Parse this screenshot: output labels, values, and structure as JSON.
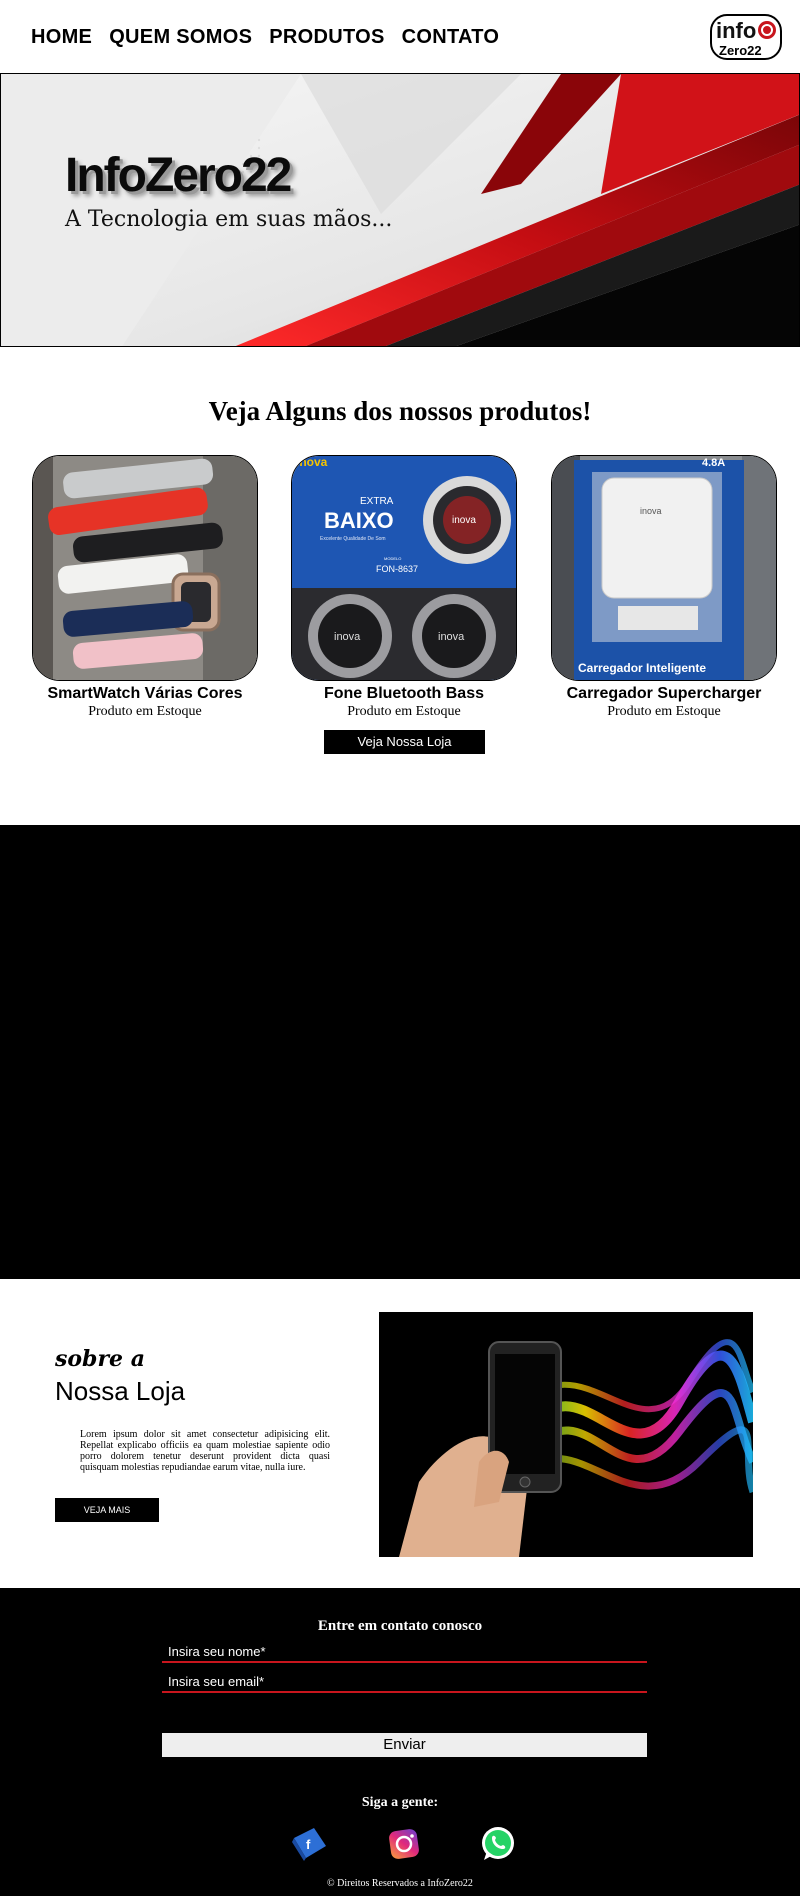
{
  "nav": {
    "items": [
      {
        "label": "HOME"
      },
      {
        "label": "QUEM SOMOS"
      },
      {
        "label": "PRODUTOS"
      },
      {
        "label": "CONTATO"
      }
    ],
    "logo_text_top": "info",
    "logo_text_bottom": "Zero22"
  },
  "hero": {
    "title": "InfoZero22",
    "subtitle": "A Tecnologia em suas mãos..."
  },
  "products": {
    "heading": "Veja Alguns dos nossos produtos!",
    "items": [
      {
        "name": "SmartWatch Várias Cores",
        "status": "Produto em Estoque"
      },
      {
        "name": "Fone Bluetooth Bass",
        "status": "Produto em Estoque",
        "photo_text": {
          "badge": "EXTRA",
          "big": "BAIXO",
          "small": "Excelente Qualidade De Som",
          "model_label": "MODELO",
          "model": "FON-8637",
          "brand": "inova"
        }
      },
      {
        "name": "Carregador Supercharger",
        "status": "Produto em Estoque",
        "photo_text": {
          "amp": "4.8A",
          "brand": "inova",
          "caption": "Carregador Inteligente"
        }
      }
    ],
    "store_button": "Veja Nossa Loja"
  },
  "about": {
    "kicker": "sobre a",
    "title": "Nossa Loja",
    "text": "Lorem ipsum dolor sit amet consectetur adipisicing elit. Repellat explicabo officiis ea quam molestiae sapiente odio porro dolorem tenetur deserunt provident dicta quasi quisquam molestias repudiandae earum vitae, nulla iure.",
    "button": "VEJA MAIS"
  },
  "contact": {
    "title": "Entre em contato conosco",
    "name_placeholder": "Insira seu nome*",
    "email_placeholder": "Insira seu email*",
    "send_button": "Enviar",
    "follow_label": "Siga a gente:",
    "copyright": "© Direitos Reservados a InfoZero22"
  },
  "colors": {
    "accent_red": "#c8151d",
    "black": "#000000",
    "white": "#ffffff"
  },
  "icons": [
    "facebook-icon",
    "instagram-icon",
    "whatsapp-icon"
  ]
}
